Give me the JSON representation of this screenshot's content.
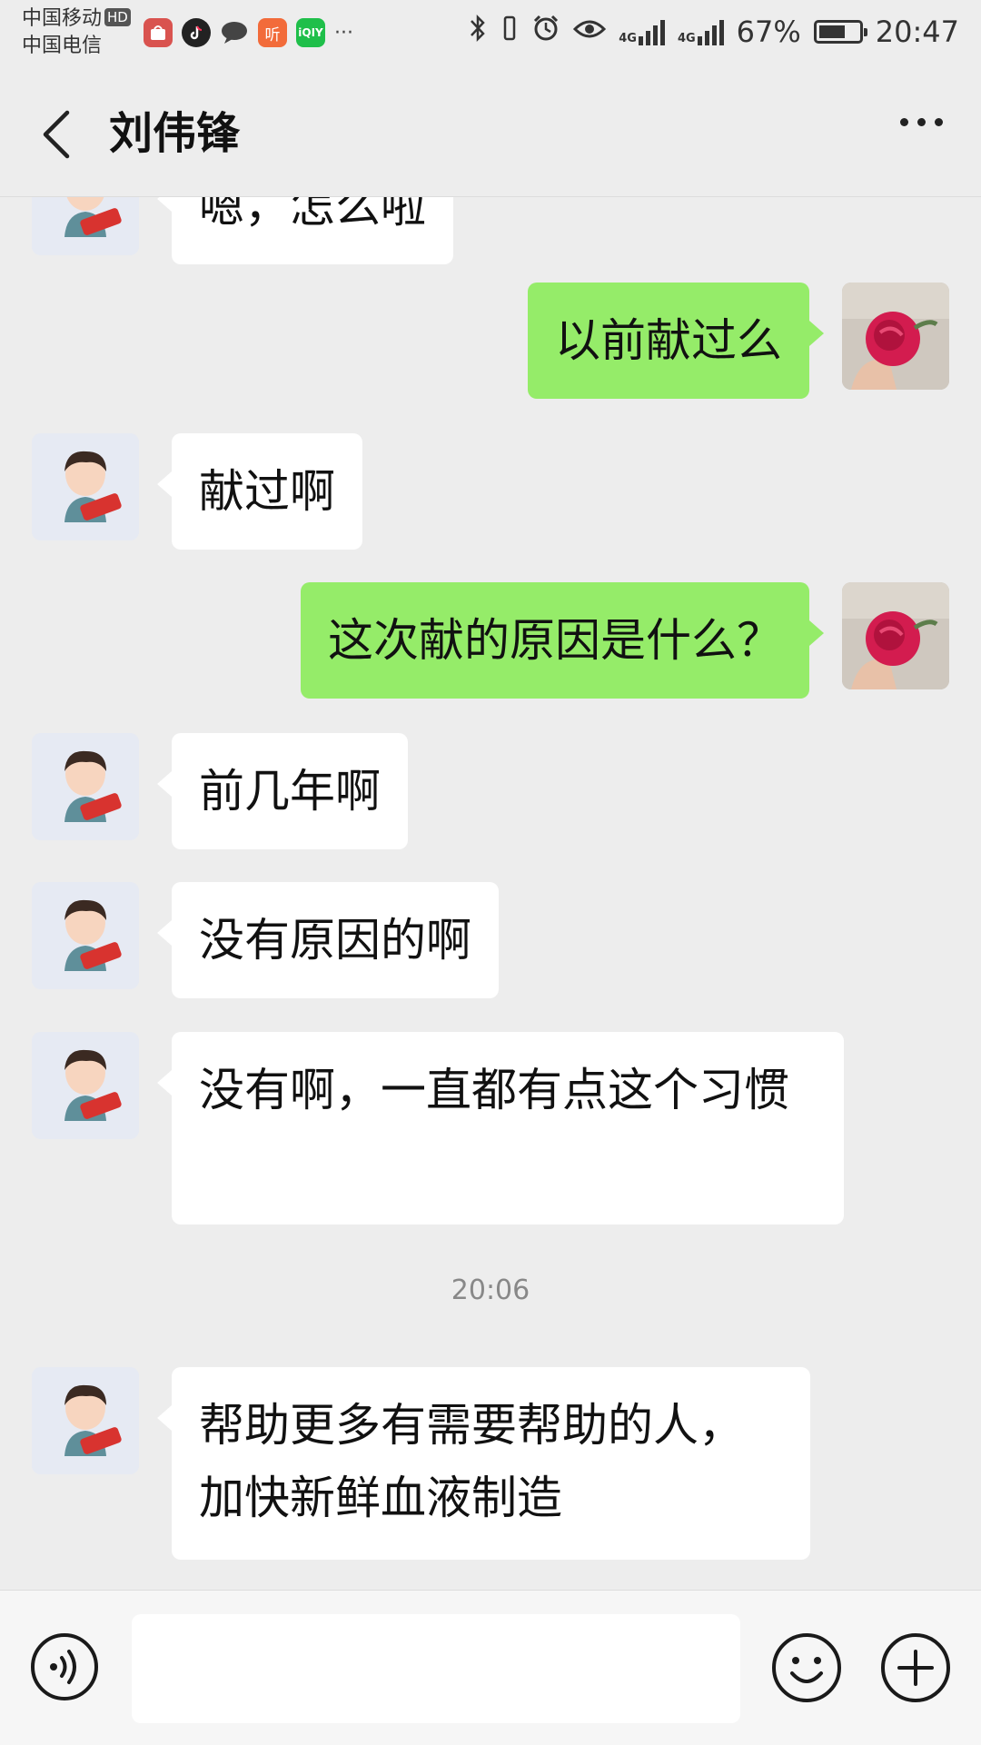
{
  "status_bar": {
    "carrier_1": "中国移动",
    "hd": "HD",
    "carrier_2": "中国电信",
    "network_1": "4G",
    "network_2": "4G",
    "battery_percent": "67%",
    "battery_level": 0.67,
    "time": "20:47",
    "apps": [
      "huawei-store-icon",
      "tiktok-icon",
      "chat-bubble-icon",
      "ting-icon",
      "iqiyi-icon"
    ],
    "more": "···"
  },
  "header": {
    "title": "刘伟锋",
    "back_icon": "chevron-left-icon",
    "more_icon": "more-dots-icon"
  },
  "messages": [
    {
      "side": "in",
      "text": "嗯，怎么啦"
    },
    {
      "side": "out",
      "text": "以前献过么"
    },
    {
      "side": "in",
      "text": "献过啊"
    },
    {
      "side": "out",
      "text": "这次献的原因是什么？"
    },
    {
      "side": "in",
      "text": "前几年啊"
    },
    {
      "side": "in",
      "text": "没有原因的啊"
    },
    {
      "side": "in",
      "text": "没有啊，一直都有点这个习惯"
    },
    {
      "side": "time",
      "text": "20:06"
    },
    {
      "side": "in",
      "text": "帮助更多有需要帮助的人，加快新鲜血液制造"
    }
  ],
  "input_bar": {
    "voice_icon": "voice-icon",
    "emoji_icon": "emoji-icon",
    "plus_icon": "plus-icon"
  },
  "colors": {
    "background": "#ededed",
    "outgoing_bubble": "#95ec69",
    "incoming_bubble": "#ffffff"
  }
}
